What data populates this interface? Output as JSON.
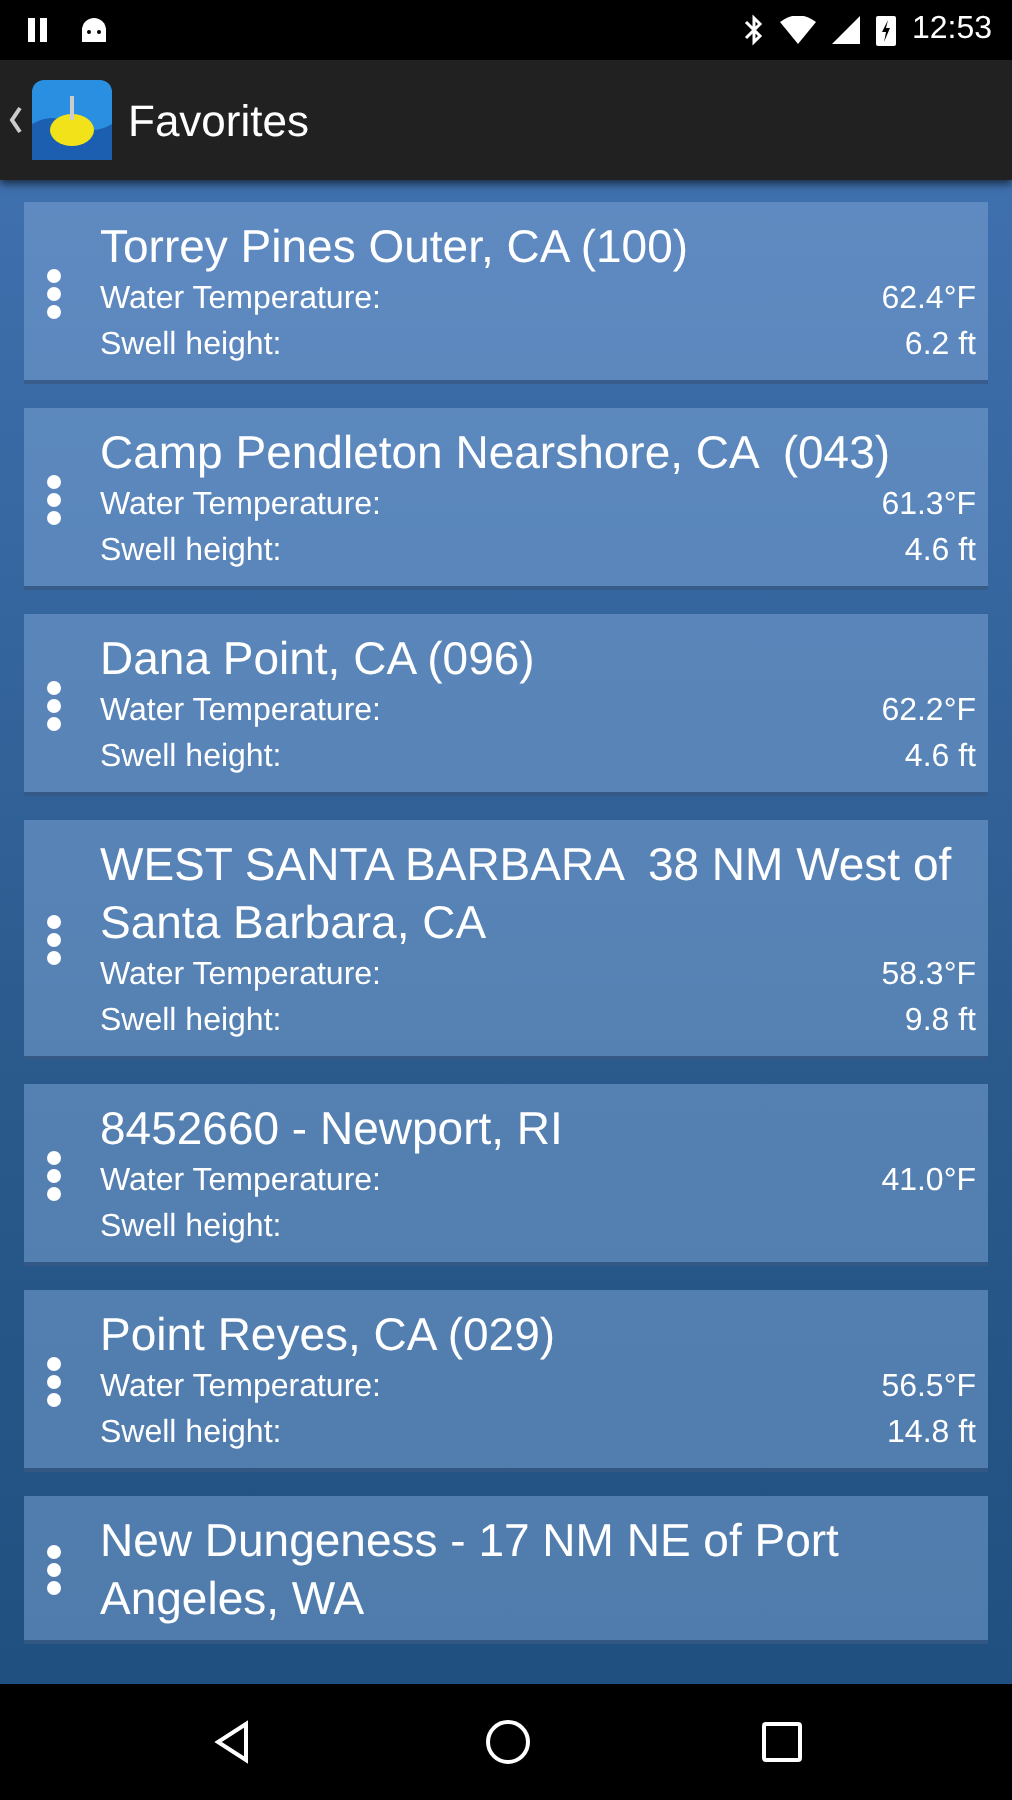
{
  "status_bar": {
    "time": "12:53"
  },
  "app_bar": {
    "title": "Favorites"
  },
  "favorites": [
    {
      "name": "Torrey Pines Outer, CA (100)",
      "rows": [
        {
          "label": "Water Temperature:",
          "value": "62.4°F"
        },
        {
          "label": "Swell height:",
          "value": "6.2 ft"
        }
      ]
    },
    {
      "name": "Camp Pendleton Nearshore, CA  (043)",
      "rows": [
        {
          "label": "Water Temperature:",
          "value": "61.3°F"
        },
        {
          "label": "Swell height:",
          "value": "4.6 ft"
        }
      ]
    },
    {
      "name": "Dana Point, CA (096)",
      "rows": [
        {
          "label": "Water Temperature:",
          "value": "62.2°F"
        },
        {
          "label": "Swell height:",
          "value": "4.6 ft"
        }
      ]
    },
    {
      "name": "WEST SANTA BARBARA  38 NM West of Santa Barbara, CA",
      "rows": [
        {
          "label": "Water Temperature:",
          "value": "58.3°F"
        },
        {
          "label": "Swell height:",
          "value": "9.8 ft"
        }
      ]
    },
    {
      "name": "8452660 - Newport, RI",
      "rows": [
        {
          "label": "Water Temperature:",
          "value": "41.0°F"
        },
        {
          "label": "Swell height:"
        }
      ]
    },
    {
      "name": "Point Reyes, CA (029)",
      "rows": [
        {
          "label": "Water Temperature:",
          "value": "56.5°F"
        },
        {
          "label": "Swell height:",
          "value": "14.8 ft"
        }
      ]
    },
    {
      "name": "New Dungeness - 17 NM NE of Port Angeles, WA"
    }
  ]
}
